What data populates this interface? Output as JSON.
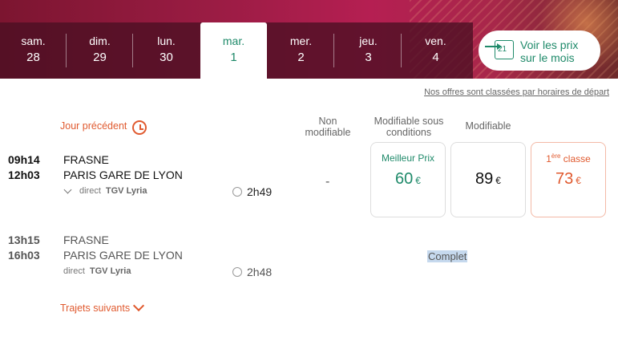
{
  "days": [
    {
      "name": "sam.",
      "date": "28"
    },
    {
      "name": "dim.",
      "date": "29"
    },
    {
      "name": "lun.",
      "date": "30"
    },
    {
      "name": "mar.",
      "date": "1"
    },
    {
      "name": "mer.",
      "date": "2"
    },
    {
      "name": "jeu.",
      "date": "3"
    },
    {
      "name": "ven.",
      "date": "4"
    }
  ],
  "month_button": {
    "label": "Voir les prix sur le mois",
    "calendar_day": "21"
  },
  "sort_note": "Nos offres sont classées par horaires de départ",
  "columns": {
    "non_modifiable": "Non modifiable",
    "modifiable_conditions": "Modifiable sous conditions",
    "modifiable": "Modifiable"
  },
  "previous_day": "Jour précédent",
  "journeys": [
    {
      "depart": "09h14",
      "arrive": "12h03",
      "from": "FRASNE",
      "to": "PARIS GARE DE LYON",
      "type": "direct",
      "train": "TGV Lyria",
      "duration": "2h49",
      "non_modifiable": "-",
      "best_label": "Meilleur Prix",
      "best_price": "60",
      "best_cur": "€",
      "mod_price": "89",
      "mod_cur": "€",
      "first_label_sup": "ère",
      "first_label_main": "1",
      "first_label_rest": " classe",
      "first_price": "73",
      "first_cur": "€"
    },
    {
      "depart": "13h15",
      "arrive": "16h03",
      "from": "FRASNE",
      "to": "PARIS GARE DE LYON",
      "type": "direct",
      "train": "TGV Lyria",
      "duration": "2h48",
      "status": "Complet"
    }
  ],
  "next_trips": "Trajets suivants",
  "colors": {
    "accent": "#e05a2f",
    "green": "#1f8a6a",
    "banner": "#9b1c44"
  }
}
